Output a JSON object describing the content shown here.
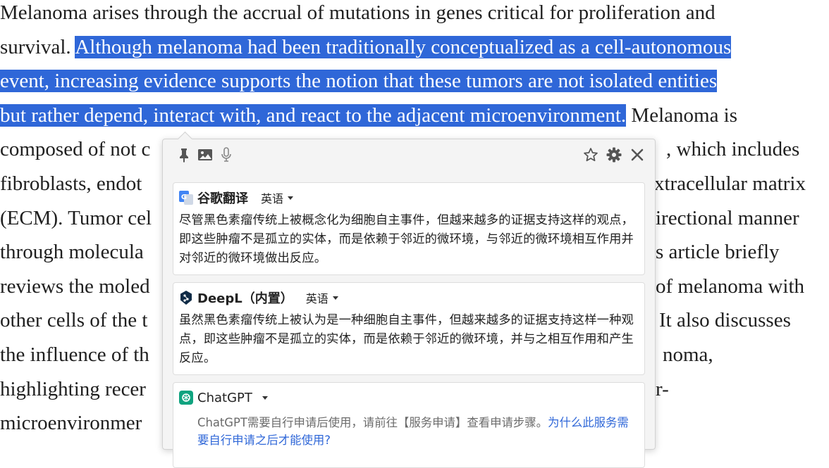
{
  "article": {
    "lines": [
      {
        "before": "Melanoma arises through the accrual of mutations in genes critical for proliferation and",
        "selected": "",
        "after": ""
      },
      {
        "before": "survival. ",
        "selected": "Although melanoma had been traditionally conceptualized as a cell-autonomous",
        "after": ""
      },
      {
        "before": "",
        "selected": "event, increasing evidence supports the notion that these tumors are not isolated entities",
        "after": ""
      },
      {
        "before": "",
        "selected": "but rather depend, interact with, and react to the adjacent microenvironment.",
        "after": " Melanoma is"
      },
      {
        "before": "composed of not c",
        "selected": "",
        "after": ""
      },
      {
        "before": "fibroblasts, endot",
        "selected": "",
        "after": ""
      },
      {
        "before": "(ECM). Tumor cel",
        "selected": "",
        "after": ""
      },
      {
        "before": "through molecula",
        "selected": "",
        "after": ""
      },
      {
        "before": "reviews the moled",
        "selected": "",
        "after": ""
      },
      {
        "before": "other cells of the t",
        "selected": "",
        "after": ""
      },
      {
        "before": "the influence of th",
        "selected": "",
        "after": ""
      },
      {
        "before": "highlighting recer",
        "selected": "",
        "after": ""
      },
      {
        "before": "microenvironmer",
        "selected": "",
        "after": ""
      }
    ],
    "right_fragments": [
      {
        "line": 4,
        "text": ", which includes"
      },
      {
        "line": 5,
        "text": "xtracellular matrix"
      },
      {
        "line": 6,
        "text": "irectional manner"
      },
      {
        "line": 7,
        "text": "s article briefly"
      },
      {
        "line": 8,
        "text": "of melanoma with"
      },
      {
        "line": 9,
        "text": "It also discusses"
      },
      {
        "line": 10,
        "text": "noma,"
      },
      {
        "line": 11,
        "text": "r-"
      }
    ]
  },
  "popup": {
    "toolbar_icons": [
      "pin-icon",
      "image-icon",
      "microphone-icon",
      "star-icon",
      "gear-icon",
      "close-icon"
    ],
    "google": {
      "name": "谷歌翻译",
      "lang": "英语",
      "text": "尽管黑色素瘤传统上被概念化为细胞自主事件，但越来越多的证据支持这样的观点，即这些肿瘤不是孤立的实体，而是依赖于邻近的微环境，与邻近的微环境相互作用并对邻近的微环境做出反应。"
    },
    "deepl": {
      "name": "DeepL（内置）",
      "lang": "英语",
      "text": "虽然黑色素瘤传统上被认为是一种细胞自主事件，但越来越多的证据支持这样一种观点，即这些肿瘤不是孤立的实体，而是依赖于邻近的微环境，并与之相互作用和产生反应。"
    },
    "chatgpt": {
      "name": "ChatGPT",
      "notice": "ChatGPT需要自行申请后使用，请前往【服务申请】查看申请步骤。",
      "link": "为什么此服务需要自行申请之后才能使用?"
    }
  },
  "colors": {
    "selection": "#2f67d8",
    "google_blue": "#4285f4",
    "deepl_navy": "#0f2b46",
    "chatgpt_green": "#10a37f"
  }
}
